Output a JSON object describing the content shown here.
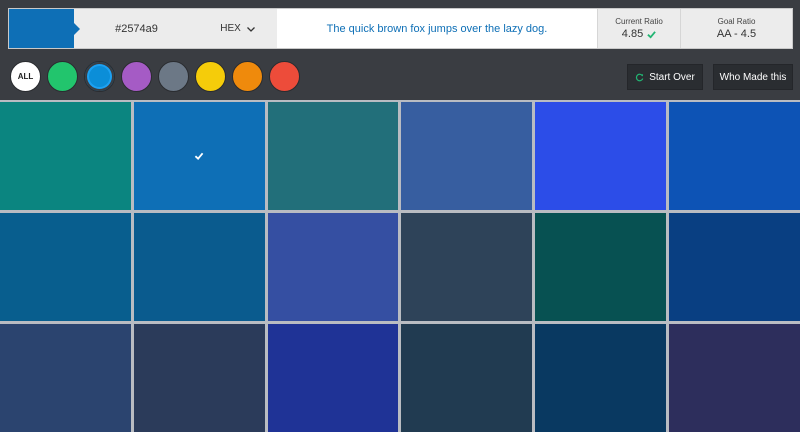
{
  "header": {
    "preview_color": "#0e6fb6",
    "hex_value": "#2574a9",
    "format_label": "HEX",
    "sample_text": "The quick brown fox jumps over the lazy dog.",
    "current_ratio_label": "Current Ratio",
    "current_ratio_value": "4.85",
    "goal_ratio_label": "Goal Ratio",
    "goal_ratio_value": "AA - 4.5"
  },
  "filters": {
    "all_label": "ALL",
    "colors": [
      "#22c56d",
      "#0b8ed8",
      "#a55bc5",
      "#6c7886",
      "#f5cc0a",
      "#ef8a0c",
      "#ed4c3a"
    ],
    "selected_index": 1
  },
  "buttons": {
    "start_over": "Start Over",
    "who_made_this": "Who Made this"
  },
  "accent": "#22b573",
  "grid": {
    "cells": [
      "#0b8580",
      "#0e6fb6",
      "#226f7a",
      "#375ea0",
      "#2c4de8",
      "#0d53b5",
      "#085e8e",
      "#0a5b8e",
      "#354fa2",
      "#2e4359",
      "#075152",
      "#093f82",
      "#2b446f",
      "#2b3b5a",
      "#1f3396",
      "#213b51",
      "#093961",
      "#2d2e5c"
    ],
    "selected_index": 1
  }
}
